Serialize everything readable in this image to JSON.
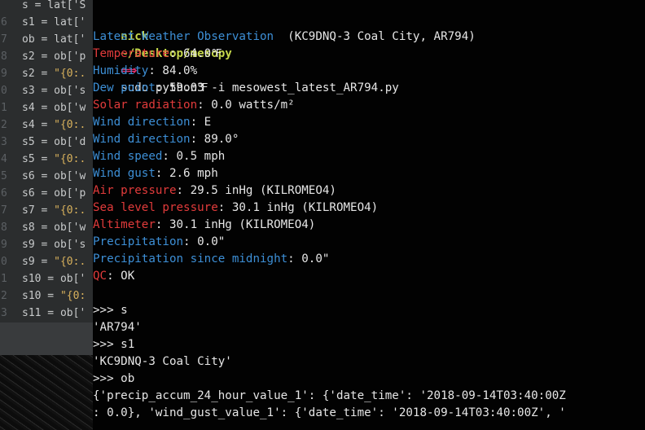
{
  "editor": {
    "lines": [
      {
        "num": "",
        "code": "s = lat['S",
        "str": ""
      },
      {
        "num": "6",
        "code": "s1 = lat['",
        "str": ""
      },
      {
        "num": "7",
        "code": "ob = lat['",
        "str": ""
      },
      {
        "num": "8",
        "code": "s2 = ob['p",
        "str": ""
      },
      {
        "num": "9",
        "code": "s2 = ",
        "str": "\"{0:."
      },
      {
        "num": "0",
        "code": "s3 = ob['s",
        "str": ""
      },
      {
        "num": "1",
        "code": "s4 = ob['w",
        "str": ""
      },
      {
        "num": "2",
        "code": "s4 = ",
        "str": "\"{0:."
      },
      {
        "num": "3",
        "code": "s5 = ob['d",
        "str": ""
      },
      {
        "num": "4",
        "code": "s5 = ",
        "str": "\"{0:."
      },
      {
        "num": "5",
        "code": "s6 = ob['w",
        "str": ""
      },
      {
        "num": "6",
        "code": "s6 = ob['p",
        "str": ""
      },
      {
        "num": "7",
        "code": "s7 = ",
        "str": "\"{0:."
      },
      {
        "num": "8",
        "code": "s8 = ob['w",
        "str": ""
      },
      {
        "num": "9",
        "code": "s9 = ob['s",
        "str": ""
      },
      {
        "num": "0",
        "code": "s9 = ",
        "str": "\"{0:."
      },
      {
        "num": "1",
        "code": "s10 = ob['",
        "str": ""
      },
      {
        "num": "2",
        "code": "s10 = ",
        "str": "\"{0:"
      },
      {
        "num": "3",
        "code": "s11 = ob['",
        "str": ""
      }
    ]
  },
  "terminal": {
    "prompt": {
      "user": "nick",
      "path": "~/Desktop/mesopy",
      "arrow": "⟹",
      "command": "sudo python3 -i mesowest_latest_AR794.py"
    },
    "header": {
      "label": "Latest Weather Observation",
      "value": "  (KC9DNQ-3 Coal City, AR794)"
    },
    "observations": [
      {
        "label": "Temperature",
        "value": ": 64.0℉",
        "color": "red"
      },
      {
        "label": "Humidity",
        "value": ": 84.0%",
        "color": "blue"
      },
      {
        "label": "Dew point",
        "value": ": 59.0℉",
        "color": "blue"
      },
      {
        "label": "Solar radiation",
        "value": ": 0.0 watts/m²",
        "color": "red"
      },
      {
        "label": "Wind direction",
        "value": ": E",
        "color": "blue"
      },
      {
        "label": "Wind direction",
        "value": ": 89.0°",
        "color": "blue"
      },
      {
        "label": "Wind speed",
        "value": ": 0.5 mph",
        "color": "blue"
      },
      {
        "label": "Wind gust",
        "value": ": 2.6 mph",
        "color": "blue"
      },
      {
        "label": "Air pressure",
        "value": ": 29.5 inHg (KILROMEO4)",
        "color": "red"
      },
      {
        "label": "Sea level pressure",
        "value": ": 30.1 inHg (KILROMEO4)",
        "color": "red"
      },
      {
        "label": "Altimeter",
        "value": ": 30.1 inHg (KILROMEO4)",
        "color": "red"
      },
      {
        "label": "Precipitation",
        "value": ": 0.0\"",
        "color": "blue"
      },
      {
        "label": "Precipitation since midnight",
        "value": ": 0.0\"",
        "color": "blue"
      },
      {
        "label": "QC",
        "value": ": OK",
        "color": "red"
      }
    ],
    "repl": [
      ">>> s",
      "'AR794'",
      ">>> s1",
      "'KC9DNQ-3 Coal City'",
      ">>> ob",
      "{'precip_accum_24_hour_value_1': {'date_time': '2018-09-14T03:40:00Z",
      ": 0.0}, 'wind_gust_value_1': {'date_time': '2018-09-14T03:40:00Z', '"
    ],
    "colors": {
      "red": "#e23b3b",
      "blue": "#3d8fd6",
      "prompt_green": "#c6d84b",
      "arrow_pink": "#e0306a"
    }
  }
}
